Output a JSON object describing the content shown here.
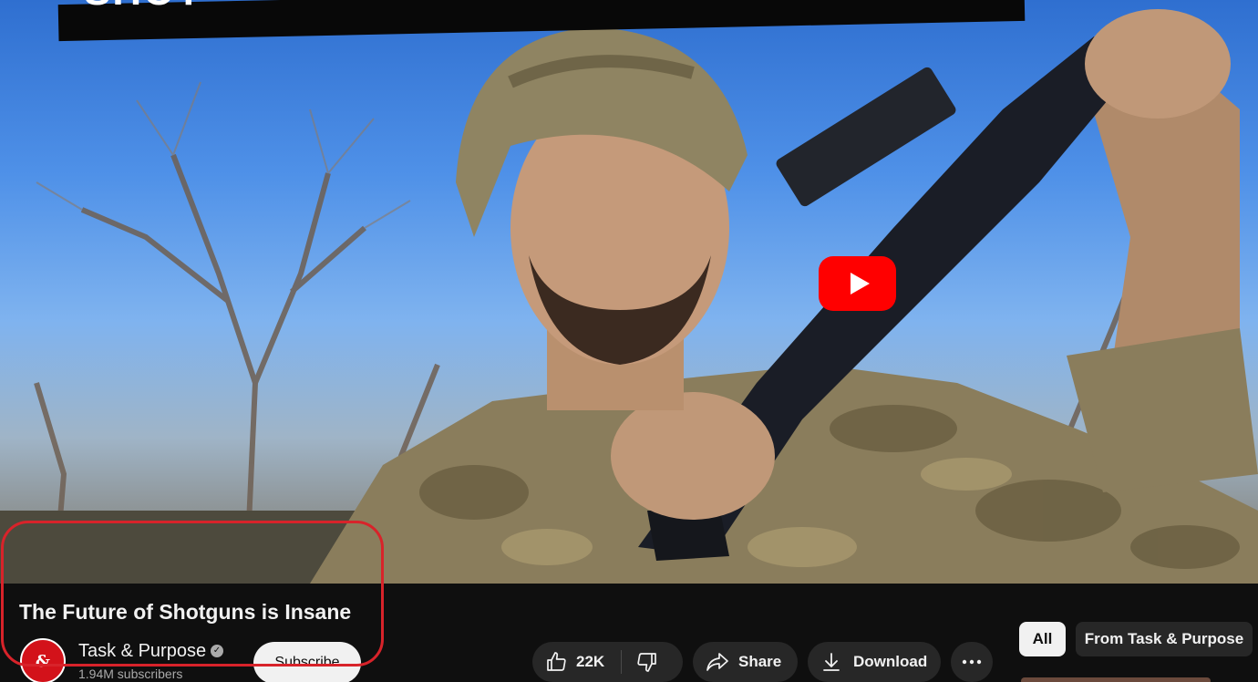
{
  "video": {
    "thumbnail_banner_text": "SHOT",
    "play_button_color": "#ff0000"
  },
  "meta": {
    "title": "The Future of Shotguns is Insane",
    "channel": {
      "name": "Task & Purpose",
      "avatar_text": "&",
      "subscribers": "1.94M subscribers",
      "verified": true
    },
    "subscribe_label": "Subscribe",
    "actions": {
      "likes": "22K",
      "share_label": "Share",
      "download_label": "Download"
    }
  },
  "chips": {
    "all_label": "All",
    "from_channel_label": "From Task & Purpose"
  },
  "colors": {
    "background": "#0f0f0f",
    "button_bg": "#272727",
    "text_primary": "#f1f1f1",
    "text_secondary": "#aaaaaa",
    "highlight": "#d8232a"
  }
}
